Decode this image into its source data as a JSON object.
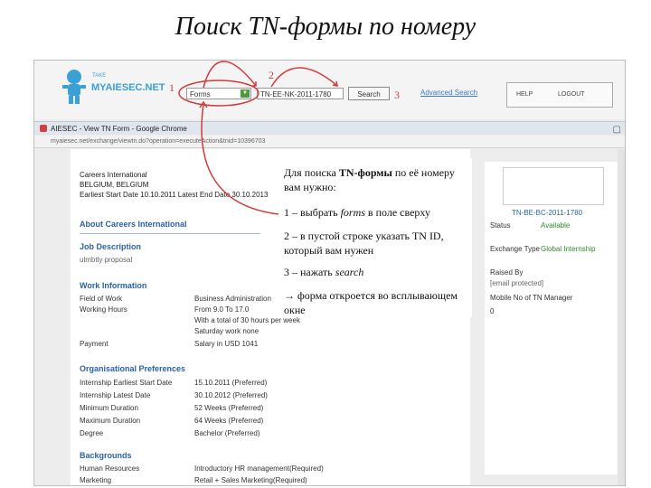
{
  "slide": {
    "title": "Поиск TN-формы по номеру"
  },
  "steps": {
    "one": "1",
    "two": "2",
    "three": "3"
  },
  "site": {
    "logo_small": "TAKE",
    "logo_text": "MYAIESEC.NET",
    "search_type": "Forms",
    "search_value": "TN-EE-NK-2011-1780",
    "search_button": "Search",
    "advanced_link": "Advanced Search",
    "help": "HELP",
    "logout": "LOGOUT"
  },
  "window": {
    "title": "AIESEC - View TN Form - Google Chrome",
    "address": "myaiesec.net/exchange/viewtn.do?operation=executeAction&tnid=10396703"
  },
  "tn_form": {
    "company": "Careers International",
    "location": "BELGIUM, BELGIUM",
    "dates": "Earliest Start Date 10.10.2011  Latest End Date 30.10.2013",
    "about_title": "About Careers International",
    "job_title": "Job Description",
    "job_text": "ulmbtly proposal",
    "work_title": "Work Information",
    "work_rows": [
      {
        "label": "Field of Work",
        "value": "Business Administration"
      },
      {
        "label": "Working Hours",
        "value": "From 9.0 To 17.0"
      },
      {
        "label": "",
        "value": "With a total of 30 hours per week"
      },
      {
        "label": "",
        "value": "Saturday work none"
      },
      {
        "label": "Payment",
        "value": "Salary in USD 1041"
      }
    ],
    "org_title": "Organisational Preferences",
    "org_rows": [
      {
        "label": "Internship Earliest Start Date",
        "value": "15.10.2011 (Preferred)"
      },
      {
        "label": "Internship Latest Date",
        "value": "30.10.2012 (Preferred)"
      },
      {
        "label": "Minimum Duration",
        "value": "52 Weeks (Preferred)"
      },
      {
        "label": "Maximum Duration",
        "value": "64 Weeks (Preferred)"
      },
      {
        "label": "Degree",
        "value": "Bachelor (Preferred)"
      }
    ],
    "bg_title": "Backgrounds",
    "bg_rows": [
      {
        "label": "Human Resources",
        "value": "Introductory HR management(Required)"
      },
      {
        "label": "Marketing",
        "value": "Retail + Sales Marketing(Required)"
      }
    ]
  },
  "side_panel": {
    "tn_id": "TN-BE-BC-2011-1780",
    "status_label": "Status",
    "status_value": "Available",
    "exchange_label": "Exchange Type",
    "exchange_value": "Global Internship",
    "raised_label": "Raised By",
    "raised_value": "[email protected]",
    "mobile_label": "Mobile No of TN Manager",
    "mobile_value": "0"
  },
  "instructions": {
    "intro_a": "Для поиска ",
    "intro_b": "TN-формы",
    "intro_c": " по её номеру вам нужно:",
    "step1_a": "1 – выбрать ",
    "step1_b": "forms",
    "step1_c": " в поле сверху",
    "step2": "2 – в пустой строке указать TN ID, который вам нужен",
    "step3_a": "3 – нажать ",
    "step3_b": "search",
    "result": " форма откроется во всплывающем окне"
  }
}
